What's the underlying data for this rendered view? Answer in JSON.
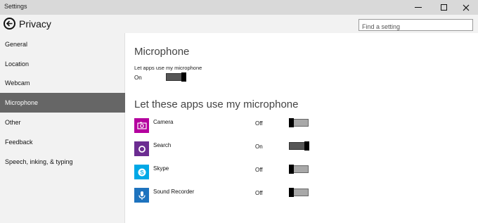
{
  "window": {
    "title": "Settings"
  },
  "header": {
    "title": "Privacy",
    "search_placeholder": "Find a setting"
  },
  "sidebar": {
    "items": [
      {
        "label": "General",
        "selected": false
      },
      {
        "label": "Location",
        "selected": false
      },
      {
        "label": "Webcam",
        "selected": false
      },
      {
        "label": "Microphone",
        "selected": true
      },
      {
        "label": "Other",
        "selected": false
      },
      {
        "label": "Feedback",
        "selected": false
      },
      {
        "label": "Speech, inking, & typing",
        "selected": false
      }
    ]
  },
  "main": {
    "heading": "Microphone",
    "master_toggle": {
      "label": "Let apps use my microphone",
      "state_text": "On",
      "on": true
    },
    "apps_heading": "Let these apps use my microphone",
    "apps": [
      {
        "name": "Camera",
        "state_text": "Off",
        "on": false,
        "icon": "camera-icon",
        "color": "#b4009e"
      },
      {
        "name": "Search",
        "state_text": "On",
        "on": true,
        "icon": "search-app-icon",
        "color": "#6b2c91"
      },
      {
        "name": "Skype",
        "state_text": "Off",
        "on": false,
        "icon": "skype-icon",
        "color": "#00a8e6"
      },
      {
        "name": "Sound Recorder",
        "state_text": "Off",
        "on": false,
        "icon": "microphone-icon",
        "color": "#1e73be"
      }
    ]
  },
  "colors": {
    "selected_nav_bg": "#666666",
    "chrome_bg": "#f2f2f2",
    "titlebar_bg": "#d9d9d9"
  }
}
